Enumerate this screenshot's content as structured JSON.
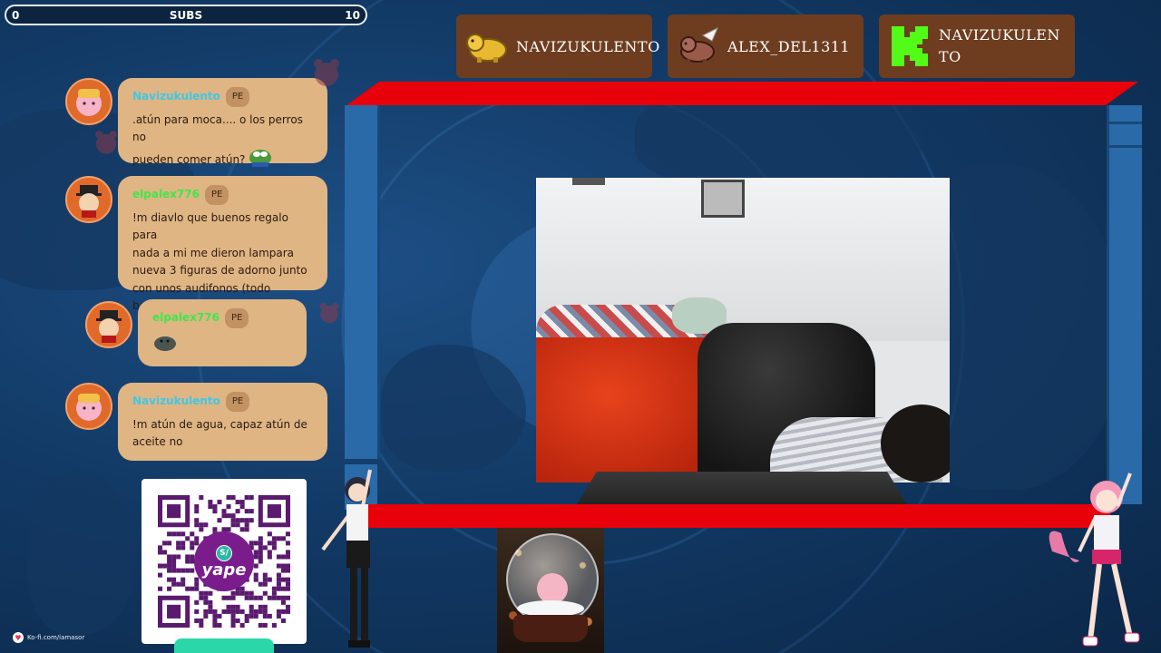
{
  "subs_bar": {
    "label": "SUBS",
    "min": "0",
    "max": "10",
    "progress": 0
  },
  "top_supporters": [
    {
      "name": "NAVIZUKULENTO",
      "icon": "gold-capybara-icon"
    },
    {
      "name": "ALEX_DEL1311",
      "icon": "winged-cow-icon"
    },
    {
      "name": "NAVIZUKULENTO",
      "icon": "kick-logo-icon"
    }
  ],
  "chat": {
    "messages": [
      {
        "user": "Navizukulento",
        "user_color": "#3ec8e8",
        "badge": "PE",
        "lines": [
          ".atún para moca.... o los perros no",
          "pueden comer atún?"
        ],
        "emote": "pepe-frog-emote"
      },
      {
        "user": "elpalex776",
        "user_color": "#3ee84a",
        "badge": "PE",
        "lines": [
          "!m diavlo que buenos regalo para",
          "nada a mi me dieron lampara",
          "nueva 3 figuras de adorno junto",
          "con unos audifonos (todo barato)"
        ],
        "emote": ""
      },
      {
        "user": "elpalex776",
        "user_color": "#3ee84a",
        "badge": "PE",
        "lines": [],
        "emote": "seal-emote"
      },
      {
        "user": "Navizukulento",
        "user_color": "#3ec8e8",
        "badge": "PE",
        "lines": [
          "!m atún de agua, capaz atún de",
          "aceite no"
        ],
        "emote": ""
      }
    ]
  },
  "qr": {
    "logo_text": "yape",
    "logo_badge": "S/"
  },
  "kofi": {
    "text": "Ko-fi.com/iamasor"
  },
  "colors": {
    "frame_red": "#e8000a",
    "frame_blue": "#2a6aa8",
    "bubble": "#e0b584",
    "supporter_bg": "#6e3d1f"
  }
}
